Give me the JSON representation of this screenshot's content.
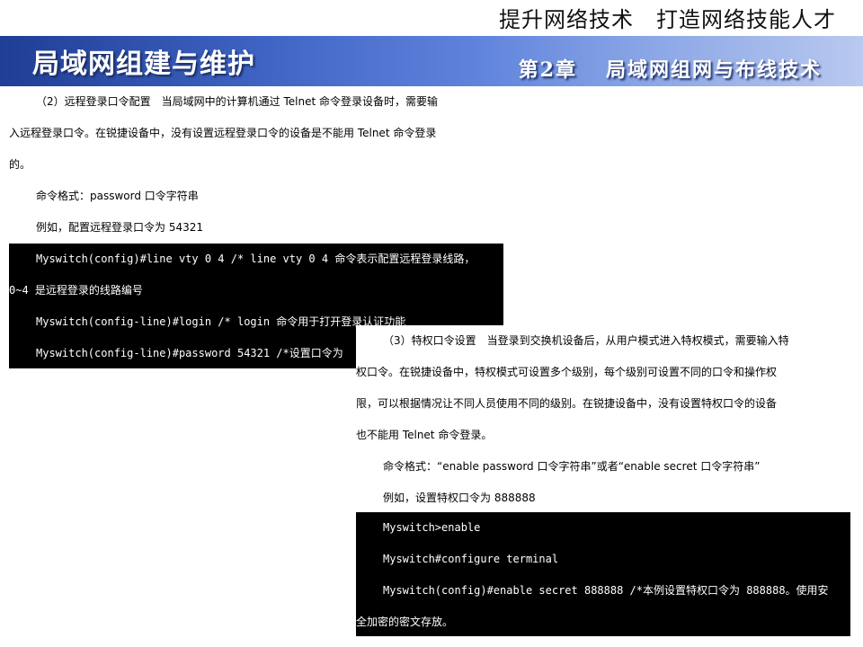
{
  "header": {
    "slogan": "提升网络技术　打造网络技能人才",
    "course_title": "局域网组建与维护",
    "chapter": "第2章",
    "chapter_title": "局域网组网与布线技术"
  },
  "section1": {
    "para": [
      "（2）远程登录口令配置　当局域网中的计算机通过 Telnet 命令登录设备时，需要输",
      "入远程登录口令。在锐捷设备中，没有设置远程登录口令的设备是不能用 Telnet 命令登录",
      "的。"
    ],
    "format": "命令格式：password 口令字符串",
    "example": "例如，配置远程登录口令为 54321",
    "terminal": [
      "Myswitch(config)#line vty 0 4   /* line vty 0 4 命令表示配置远程登录线路，",
      "0~4 是远程登录的线路编号",
      "Myswitch(config-line)#login   /* login 命令用于打开登录认证功能",
      "Myswitch(config-line)#password 54321  /*设置口令为"
    ]
  },
  "section2": {
    "para": [
      "（3）特权口令设置　当登录到交换机设备后，从用户模式进入特权模式，需要输入特",
      "权口令。在锐捷设备中，特权模式可设置多个级别，每个级别可设置不同的口令和操作权",
      "限，可以根据情况让不同人员使用不同的级别。在锐捷设备中，没有设置特权口令的设备",
      "也不能用 Telnet 命令登录。"
    ],
    "format": "命令格式：“enable password 口令字符串”或者“enable secret 口令字符串”",
    "example": "例如，设置特权口令为 888888",
    "terminal": [
      "Myswitch>enable",
      "Myswitch#configure terminal",
      "Myswitch(config)#enable secret 888888  /*本例设置特权口令为 888888。使用安",
      "全加密的密文存放。"
    ]
  }
}
